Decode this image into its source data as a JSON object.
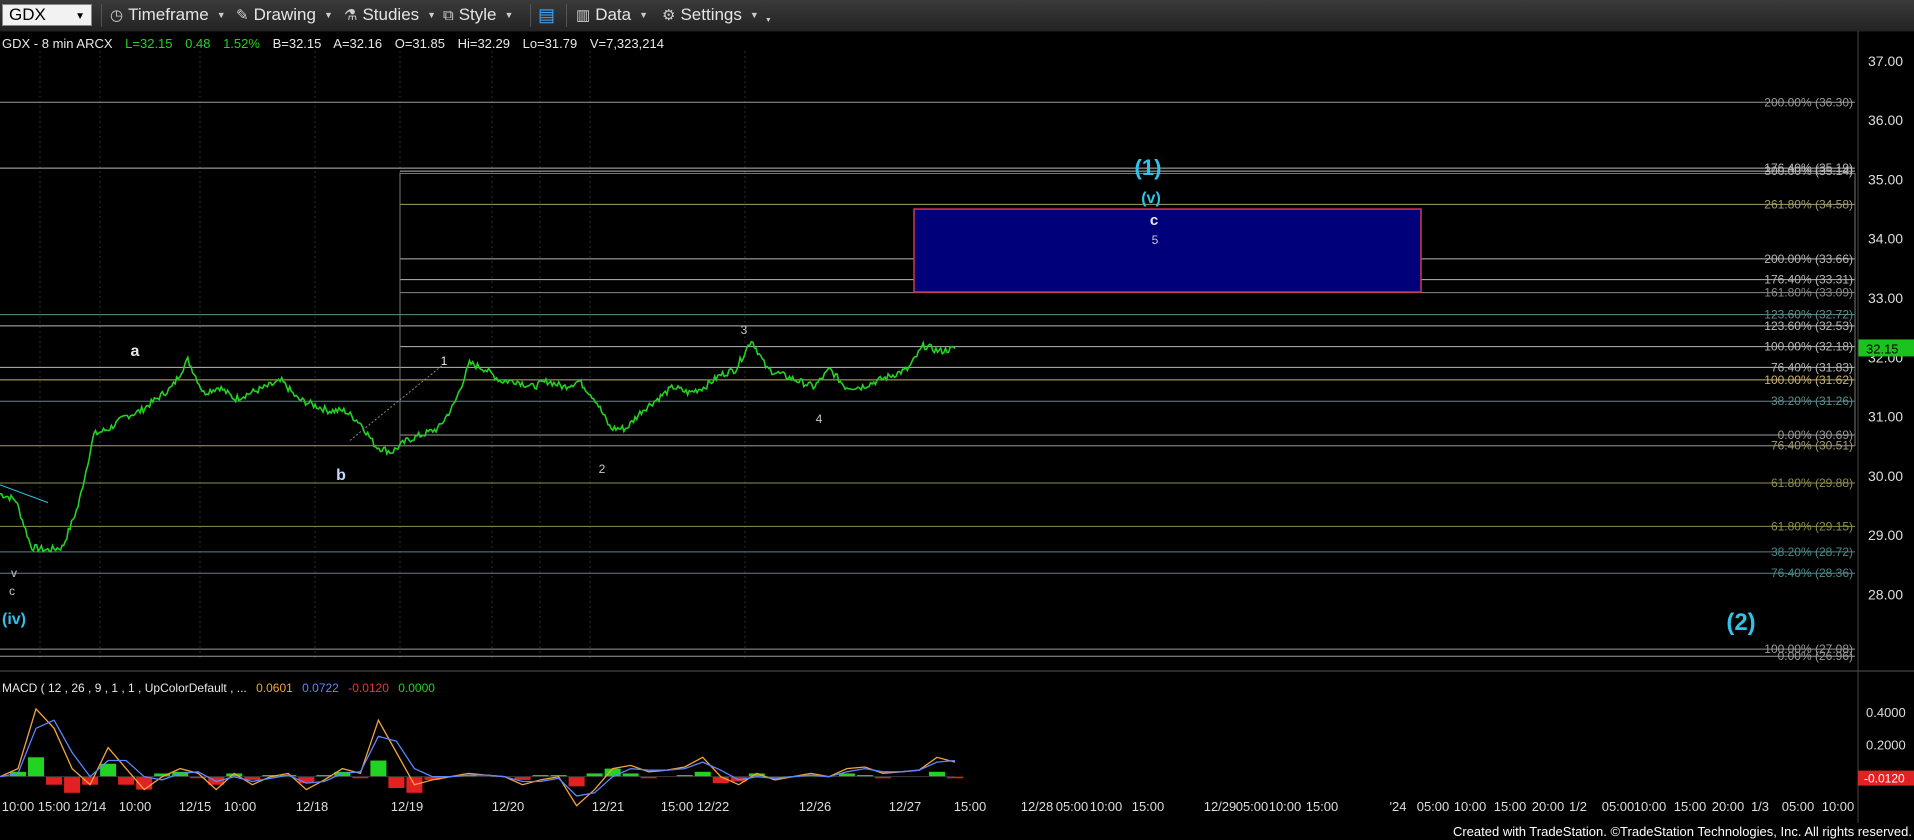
{
  "toolbar": {
    "symbol": "GDX",
    "timeframe": "Timeframe",
    "drawing": "Drawing",
    "studies": "Studies",
    "style": "Style",
    "data": "Data",
    "settings": "Settings"
  },
  "header": {
    "title": "GDX - 8 min  ARCX",
    "last": "L=32.15",
    "change": "0.48",
    "pct": "1.52%",
    "bid": "B=32.15",
    "ask": "A=32.16",
    "open": "O=31.85",
    "high": "Hi=32.29",
    "low": "Lo=31.79",
    "volume": "V=7,323,214"
  },
  "macd_header": {
    "label": "MACD ( 12 , 26 , 9 , 1 , 1 , UpColorDefault , ...",
    "v1": "0.0601",
    "v2": "0.0722",
    "v3": "-0.0120",
    "v4": "0.0000"
  },
  "footer": "Created with TradeStation. ©TradeStation Technologies, Inc. All rights reserved.",
  "colors": {
    "price": "#22d322",
    "accent_blue": "#2ec4e8",
    "target_box": "#00007a",
    "last_price_bg": "#1ec21e",
    "macd_bg": "#e22222"
  },
  "chart_data": [
    {
      "type": "line",
      "title": "GDX - 8 min",
      "ylim": [
        27.2,
        37.3
      ],
      "y_ticks": [
        "37.00",
        "36.00",
        "35.00",
        "34.00",
        "33.00",
        "32.00",
        "31.00",
        "30.00",
        "29.00",
        "28.00"
      ],
      "x_ticks": [
        "10:00",
        "15:00",
        "12/14",
        "10:00",
        "12/15",
        "10:00",
        "12/18",
        "12/19",
        "12/20",
        "12/21",
        "15:00",
        "12/22",
        "12/26",
        "12/27",
        "15:00",
        "12/28",
        "05:00",
        "10:00",
        "15:00",
        "12/29",
        "05:00",
        "10:00",
        "15:00",
        "'24",
        "05:00",
        "10:00",
        "15:00",
        "20:00",
        "1/2",
        "05:00",
        "10:00",
        "15:00",
        "20:00",
        "1/3",
        "05:00",
        "10:00"
      ],
      "last_price": "32.15",
      "series": [
        {
          "values": [
            29.7,
            29.6,
            28.8,
            28.75,
            28.8,
            29.5,
            30.7,
            30.8,
            31.0,
            31.1,
            31.3,
            31.5,
            31.96,
            31.4,
            31.5,
            31.3,
            31.4,
            31.5,
            31.6,
            31.3,
            31.2,
            31.1,
            31.1,
            30.9,
            30.5,
            30.4,
            30.6,
            30.7,
            30.8,
            31.2,
            31.9,
            31.8,
            31.6,
            31.6,
            31.5,
            31.6,
            31.5,
            31.6,
            31.3,
            30.8,
            30.8,
            31.1,
            31.3,
            31.5,
            31.4,
            31.5,
            31.7,
            31.8,
            32.3,
            31.8,
            31.7,
            31.6,
            31.5,
            31.8,
            31.5,
            31.5,
            31.6,
            31.7,
            31.8,
            32.2,
            32.1,
            32.15
          ]
        }
      ],
      "fib_levels": [
        {
          "label": "200.00% (36.30)",
          "value": 36.3
        },
        {
          "label": "176.40% (35.19)",
          "value": 35.19
        },
        {
          "label": "300.00% (35.14)",
          "value": 35.14
        },
        {
          "label": "261.80% (34.58)",
          "value": 34.58
        },
        {
          "label": "200.00% (33.66)",
          "value": 33.66
        },
        {
          "label": "176.40% (33.31)",
          "value": 33.31
        },
        {
          "label": "161.80% (33.09)",
          "value": 33.09
        },
        {
          "label": "123.60% (32.72)",
          "value": 32.72
        },
        {
          "label": "123.60% (32.53)",
          "value": 32.53
        },
        {
          "label": "100.00% (32.18)",
          "value": 32.18
        },
        {
          "label": "76.40% (31.83)",
          "value": 31.83
        },
        {
          "label": "100.00% (31.62)",
          "value": 31.62
        },
        {
          "label": "38.20% (31.26)",
          "value": 31.26
        },
        {
          "label": "0.00% (30.69)",
          "value": 30.69
        },
        {
          "label": "76.40% (30.51)",
          "value": 30.51
        },
        {
          "label": "61.80% (29.88)",
          "value": 29.88
        },
        {
          "label": "61.80% (29.15)",
          "value": 29.15
        },
        {
          "label": "38.20% (28.72)",
          "value": 28.72
        },
        {
          "label": "76.40% (28.36)",
          "value": 28.36
        },
        {
          "label": "100.00% (27.08)",
          "value": 27.08
        },
        {
          "label": "0.00% (26.96)",
          "value": 26.96
        }
      ],
      "wave_labels": [
        {
          "text": "(1)",
          "role": "major"
        },
        {
          "text": "(v)",
          "role": "minor"
        },
        {
          "text": "c",
          "role": "sub"
        },
        {
          "text": "5",
          "role": "sub"
        },
        {
          "text": "a",
          "role": "sub"
        },
        {
          "text": "b",
          "role": "sub"
        },
        {
          "text": "1",
          "role": "small"
        },
        {
          "text": "2",
          "role": "small"
        },
        {
          "text": "3",
          "role": "small"
        },
        {
          "text": "4",
          "role": "small"
        },
        {
          "text": "v",
          "role": "small"
        },
        {
          "text": "c",
          "role": "small"
        },
        {
          "text": "(iv)",
          "role": "minor"
        },
        {
          "text": "(2)",
          "role": "major"
        }
      ],
      "target_zone": {
        "from": 33.1,
        "to": 34.5
      }
    },
    {
      "type": "line",
      "title": "MACD",
      "ylim": [
        -0.25,
        0.5
      ],
      "y_ticks": [
        "0.4000",
        "0.2000"
      ],
      "last_value": "-0.0120",
      "series": [
        {
          "name": "MACD",
          "values": [
            0.0,
            0.05,
            0.42,
            0.3,
            0.05,
            -0.05,
            0.18,
            0.05,
            -0.08,
            0.0,
            0.05,
            0.02,
            -0.08,
            0.02,
            -0.05,
            0.0,
            0.02,
            -0.08,
            -0.02,
            0.05,
            0.02,
            0.35,
            0.15,
            -0.05,
            -0.02,
            0.0,
            0.02,
            0.01,
            0.0,
            -0.05,
            -0.02,
            0.0,
            -0.18,
            -0.08,
            0.05,
            0.07,
            0.03,
            0.04,
            0.06,
            0.12,
            0.0,
            -0.05,
            0.02,
            -0.02,
            0.0,
            0.02,
            0.0,
            0.05,
            0.06,
            0.02,
            0.03,
            0.04,
            0.12,
            0.09
          ]
        },
        {
          "name": "Signal",
          "values": [
            0.0,
            0.02,
            0.3,
            0.35,
            0.15,
            0.0,
            0.1,
            0.1,
            0.0,
            -0.02,
            0.02,
            0.03,
            -0.03,
            0.0,
            -0.03,
            -0.01,
            0.01,
            -0.04,
            -0.03,
            0.02,
            0.03,
            0.25,
            0.22,
            0.05,
            0.0,
            0.0,
            0.01,
            0.01,
            0.0,
            -0.03,
            -0.03,
            -0.01,
            -0.12,
            -0.1,
            0.0,
            0.05,
            0.04,
            0.04,
            0.05,
            0.09,
            0.04,
            -0.02,
            0.0,
            -0.01,
            0.0,
            0.01,
            0.0,
            0.03,
            0.05,
            0.03,
            0.03,
            0.04,
            0.09,
            0.1
          ]
        }
      ]
    }
  ]
}
